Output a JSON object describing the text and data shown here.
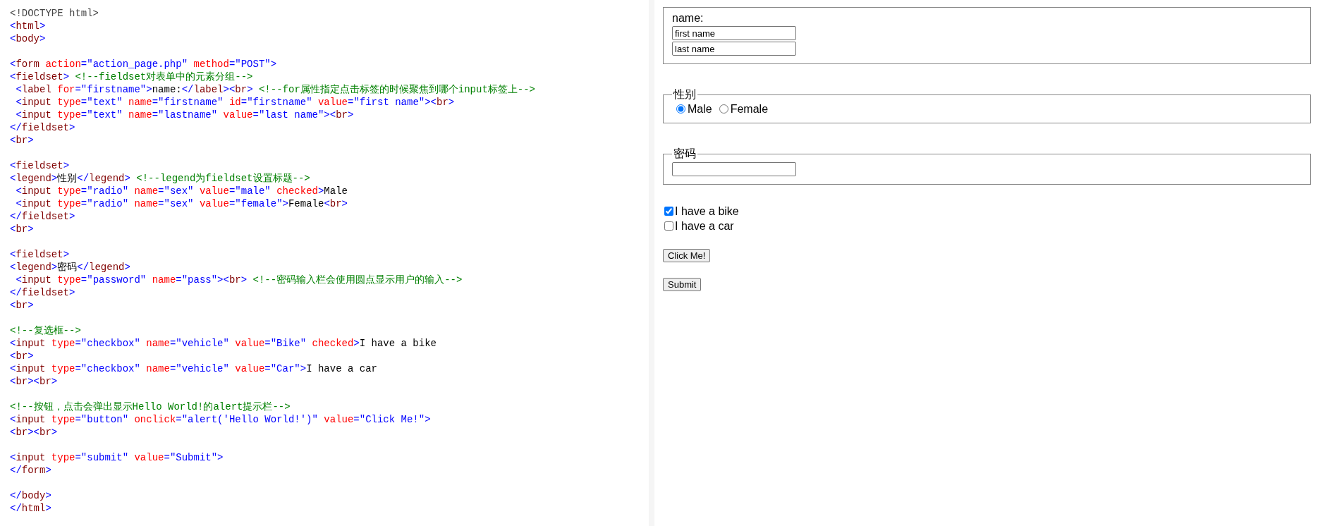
{
  "code": {
    "lines": [
      {
        "kind": "code",
        "segments": [
          {
            "kind": "doctype",
            "text": "<!DOCTYPE html>"
          }
        ]
      },
      {
        "kind": "code",
        "segments": [
          {
            "kind": "punct",
            "text": "<"
          },
          {
            "kind": "tag",
            "text": "html"
          },
          {
            "kind": "punct",
            "text": ">"
          }
        ]
      },
      {
        "kind": "code",
        "segments": [
          {
            "kind": "punct",
            "text": "<"
          },
          {
            "kind": "tag",
            "text": "body"
          },
          {
            "kind": "punct",
            "text": ">"
          }
        ]
      },
      {
        "kind": "blank"
      },
      {
        "kind": "code",
        "segments": [
          {
            "kind": "punct",
            "text": "<"
          },
          {
            "kind": "tag",
            "text": "form "
          },
          {
            "kind": "attr",
            "text": "action"
          },
          {
            "kind": "punct",
            "text": "="
          },
          {
            "kind": "value",
            "text": "\"action_page.php\" "
          },
          {
            "kind": "attr",
            "text": "method"
          },
          {
            "kind": "punct",
            "text": "="
          },
          {
            "kind": "value",
            "text": "\"POST\""
          },
          {
            "kind": "punct",
            "text": ">"
          }
        ]
      },
      {
        "kind": "code",
        "segments": [
          {
            "kind": "punct",
            "text": "<"
          },
          {
            "kind": "tag",
            "text": "fieldset"
          },
          {
            "kind": "punct",
            "text": "> "
          },
          {
            "kind": "comment",
            "text": "<!--fieldset对表单中的元素分组-->"
          }
        ]
      },
      {
        "kind": "code",
        "segments": [
          {
            "kind": "punct",
            "text": " <"
          },
          {
            "kind": "tag",
            "text": "label "
          },
          {
            "kind": "attr",
            "text": "for"
          },
          {
            "kind": "punct",
            "text": "="
          },
          {
            "kind": "value",
            "text": "\"firstname\""
          },
          {
            "kind": "punct",
            "text": ">"
          },
          {
            "kind": "text",
            "text": "name:"
          },
          {
            "kind": "punct",
            "text": "</"
          },
          {
            "kind": "tag",
            "text": "label"
          },
          {
            "kind": "punct",
            "text": "><"
          },
          {
            "kind": "tag",
            "text": "br"
          },
          {
            "kind": "punct",
            "text": "> "
          },
          {
            "kind": "comment",
            "text": "<!--for属性指定点击标签的时候聚焦到哪个input标签上-->"
          }
        ]
      },
      {
        "kind": "code",
        "segments": [
          {
            "kind": "punct",
            "text": " <"
          },
          {
            "kind": "tag",
            "text": "input "
          },
          {
            "kind": "attr",
            "text": "type"
          },
          {
            "kind": "punct",
            "text": "="
          },
          {
            "kind": "value",
            "text": "\"text\" "
          },
          {
            "kind": "attr",
            "text": "name"
          },
          {
            "kind": "punct",
            "text": "="
          },
          {
            "kind": "value",
            "text": "\"firstname\" "
          },
          {
            "kind": "attr",
            "text": "id"
          },
          {
            "kind": "punct",
            "text": "="
          },
          {
            "kind": "value",
            "text": "\"firstname\" "
          },
          {
            "kind": "attr",
            "text": "value"
          },
          {
            "kind": "punct",
            "text": "="
          },
          {
            "kind": "value",
            "text": "\"first name\""
          },
          {
            "kind": "punct",
            "text": "><"
          },
          {
            "kind": "tag",
            "text": "br"
          },
          {
            "kind": "punct",
            "text": ">"
          }
        ]
      },
      {
        "kind": "code",
        "segments": [
          {
            "kind": "punct",
            "text": " <"
          },
          {
            "kind": "tag",
            "text": "input "
          },
          {
            "kind": "attr",
            "text": "type"
          },
          {
            "kind": "punct",
            "text": "="
          },
          {
            "kind": "value",
            "text": "\"text\" "
          },
          {
            "kind": "attr",
            "text": "name"
          },
          {
            "kind": "punct",
            "text": "="
          },
          {
            "kind": "value",
            "text": "\"lastname\" "
          },
          {
            "kind": "attr",
            "text": "value"
          },
          {
            "kind": "punct",
            "text": "="
          },
          {
            "kind": "value",
            "text": "\"last name\""
          },
          {
            "kind": "punct",
            "text": "><"
          },
          {
            "kind": "tag",
            "text": "br"
          },
          {
            "kind": "punct",
            "text": ">"
          }
        ]
      },
      {
        "kind": "code",
        "segments": [
          {
            "kind": "punct",
            "text": "</"
          },
          {
            "kind": "tag",
            "text": "fieldset"
          },
          {
            "kind": "punct",
            "text": ">"
          }
        ]
      },
      {
        "kind": "code",
        "segments": [
          {
            "kind": "punct",
            "text": "<"
          },
          {
            "kind": "tag",
            "text": "br"
          },
          {
            "kind": "punct",
            "text": ">"
          }
        ]
      },
      {
        "kind": "blank"
      },
      {
        "kind": "code",
        "segments": [
          {
            "kind": "punct",
            "text": "<"
          },
          {
            "kind": "tag",
            "text": "fieldset"
          },
          {
            "kind": "punct",
            "text": ">"
          }
        ]
      },
      {
        "kind": "code",
        "segments": [
          {
            "kind": "punct",
            "text": "<"
          },
          {
            "kind": "tag",
            "text": "legend"
          },
          {
            "kind": "punct",
            "text": ">"
          },
          {
            "kind": "text",
            "text": "性别"
          },
          {
            "kind": "punct",
            "text": "</"
          },
          {
            "kind": "tag",
            "text": "legend"
          },
          {
            "kind": "punct",
            "text": "> "
          },
          {
            "kind": "comment",
            "text": "<!--legend为fieldset设置标题-->"
          }
        ]
      },
      {
        "kind": "code",
        "segments": [
          {
            "kind": "punct",
            "text": " <"
          },
          {
            "kind": "tag",
            "text": "input "
          },
          {
            "kind": "attr",
            "text": "type"
          },
          {
            "kind": "punct",
            "text": "="
          },
          {
            "kind": "value",
            "text": "\"radio\" "
          },
          {
            "kind": "attr",
            "text": "name"
          },
          {
            "kind": "punct",
            "text": "="
          },
          {
            "kind": "value",
            "text": "\"sex\" "
          },
          {
            "kind": "attr",
            "text": "value"
          },
          {
            "kind": "punct",
            "text": "="
          },
          {
            "kind": "value",
            "text": "\"male\" "
          },
          {
            "kind": "attr",
            "text": "checked"
          },
          {
            "kind": "punct",
            "text": ">"
          },
          {
            "kind": "text",
            "text": "Male"
          }
        ]
      },
      {
        "kind": "code",
        "segments": [
          {
            "kind": "punct",
            "text": " <"
          },
          {
            "kind": "tag",
            "text": "input "
          },
          {
            "kind": "attr",
            "text": "type"
          },
          {
            "kind": "punct",
            "text": "="
          },
          {
            "kind": "value",
            "text": "\"radio\" "
          },
          {
            "kind": "attr",
            "text": "name"
          },
          {
            "kind": "punct",
            "text": "="
          },
          {
            "kind": "value",
            "text": "\"sex\" "
          },
          {
            "kind": "attr",
            "text": "value"
          },
          {
            "kind": "punct",
            "text": "="
          },
          {
            "kind": "value",
            "text": "\"female\""
          },
          {
            "kind": "punct",
            "text": ">"
          },
          {
            "kind": "text",
            "text": "Female"
          },
          {
            "kind": "punct",
            "text": "<"
          },
          {
            "kind": "tag",
            "text": "br"
          },
          {
            "kind": "punct",
            "text": ">"
          }
        ]
      },
      {
        "kind": "code",
        "segments": [
          {
            "kind": "punct",
            "text": "</"
          },
          {
            "kind": "tag",
            "text": "fieldset"
          },
          {
            "kind": "punct",
            "text": ">"
          }
        ]
      },
      {
        "kind": "code",
        "segments": [
          {
            "kind": "punct",
            "text": "<"
          },
          {
            "kind": "tag",
            "text": "br"
          },
          {
            "kind": "punct",
            "text": ">"
          }
        ]
      },
      {
        "kind": "blank"
      },
      {
        "kind": "code",
        "segments": [
          {
            "kind": "punct",
            "text": "<"
          },
          {
            "kind": "tag",
            "text": "fieldset"
          },
          {
            "kind": "punct",
            "text": ">"
          }
        ]
      },
      {
        "kind": "code",
        "segments": [
          {
            "kind": "punct",
            "text": "<"
          },
          {
            "kind": "tag",
            "text": "legend"
          },
          {
            "kind": "punct",
            "text": ">"
          },
          {
            "kind": "text",
            "text": "密码"
          },
          {
            "kind": "punct",
            "text": "</"
          },
          {
            "kind": "tag",
            "text": "legend"
          },
          {
            "kind": "punct",
            "text": ">"
          }
        ]
      },
      {
        "kind": "code",
        "segments": [
          {
            "kind": "punct",
            "text": " <"
          },
          {
            "kind": "tag",
            "text": "input "
          },
          {
            "kind": "attr",
            "text": "type"
          },
          {
            "kind": "punct",
            "text": "="
          },
          {
            "kind": "value",
            "text": "\"password\" "
          },
          {
            "kind": "attr",
            "text": "name"
          },
          {
            "kind": "punct",
            "text": "="
          },
          {
            "kind": "value",
            "text": "\"pass\""
          },
          {
            "kind": "punct",
            "text": "><"
          },
          {
            "kind": "tag",
            "text": "br"
          },
          {
            "kind": "punct",
            "text": "> "
          },
          {
            "kind": "comment",
            "text": "<!--密码输入栏会使用圆点显示用户的输入-->"
          }
        ]
      },
      {
        "kind": "code",
        "segments": [
          {
            "kind": "punct",
            "text": "</"
          },
          {
            "kind": "tag",
            "text": "fieldset"
          },
          {
            "kind": "punct",
            "text": ">"
          }
        ]
      },
      {
        "kind": "code",
        "segments": [
          {
            "kind": "punct",
            "text": "<"
          },
          {
            "kind": "tag",
            "text": "br"
          },
          {
            "kind": "punct",
            "text": ">"
          }
        ]
      },
      {
        "kind": "blank"
      },
      {
        "kind": "code",
        "segments": [
          {
            "kind": "comment",
            "text": "<!--复选框-->"
          }
        ]
      },
      {
        "kind": "code",
        "segments": [
          {
            "kind": "punct",
            "text": "<"
          },
          {
            "kind": "tag",
            "text": "input "
          },
          {
            "kind": "attr",
            "text": "type"
          },
          {
            "kind": "punct",
            "text": "="
          },
          {
            "kind": "value",
            "text": "\"checkbox\" "
          },
          {
            "kind": "attr",
            "text": "name"
          },
          {
            "kind": "punct",
            "text": "="
          },
          {
            "kind": "value",
            "text": "\"vehicle\" "
          },
          {
            "kind": "attr",
            "text": "value"
          },
          {
            "kind": "punct",
            "text": "="
          },
          {
            "kind": "value",
            "text": "\"Bike\" "
          },
          {
            "kind": "attr",
            "text": "checked"
          },
          {
            "kind": "punct",
            "text": ">"
          },
          {
            "kind": "text",
            "text": "I have a bike"
          }
        ]
      },
      {
        "kind": "code",
        "segments": [
          {
            "kind": "punct",
            "text": "<"
          },
          {
            "kind": "tag",
            "text": "br"
          },
          {
            "kind": "punct",
            "text": ">"
          }
        ]
      },
      {
        "kind": "code",
        "segments": [
          {
            "kind": "punct",
            "text": "<"
          },
          {
            "kind": "tag",
            "text": "input "
          },
          {
            "kind": "attr",
            "text": "type"
          },
          {
            "kind": "punct",
            "text": "="
          },
          {
            "kind": "value",
            "text": "\"checkbox\" "
          },
          {
            "kind": "attr",
            "text": "name"
          },
          {
            "kind": "punct",
            "text": "="
          },
          {
            "kind": "value",
            "text": "\"vehicle\" "
          },
          {
            "kind": "attr",
            "text": "value"
          },
          {
            "kind": "punct",
            "text": "="
          },
          {
            "kind": "value",
            "text": "\"Car\""
          },
          {
            "kind": "punct",
            "text": ">"
          },
          {
            "kind": "text",
            "text": "I have a car"
          }
        ]
      },
      {
        "kind": "code",
        "segments": [
          {
            "kind": "punct",
            "text": "<"
          },
          {
            "kind": "tag",
            "text": "br"
          },
          {
            "kind": "punct",
            "text": "><"
          },
          {
            "kind": "tag",
            "text": "br"
          },
          {
            "kind": "punct",
            "text": ">"
          }
        ]
      },
      {
        "kind": "blank"
      },
      {
        "kind": "code",
        "segments": [
          {
            "kind": "comment",
            "text": "<!--按钮，点击会弹出显示Hello World!的alert提示栏-->"
          }
        ]
      },
      {
        "kind": "code",
        "segments": [
          {
            "kind": "punct",
            "text": "<"
          },
          {
            "kind": "tag",
            "text": "input "
          },
          {
            "kind": "attr",
            "text": "type"
          },
          {
            "kind": "punct",
            "text": "="
          },
          {
            "kind": "value",
            "text": "\"button\" "
          },
          {
            "kind": "attr",
            "text": "onclick"
          },
          {
            "kind": "punct",
            "text": "="
          },
          {
            "kind": "value",
            "text": "\"alert('Hello World!')\" "
          },
          {
            "kind": "attr",
            "text": "value"
          },
          {
            "kind": "punct",
            "text": "="
          },
          {
            "kind": "value",
            "text": "\"Click Me!\""
          },
          {
            "kind": "punct",
            "text": ">"
          }
        ]
      },
      {
        "kind": "code",
        "segments": [
          {
            "kind": "punct",
            "text": "<"
          },
          {
            "kind": "tag",
            "text": "br"
          },
          {
            "kind": "punct",
            "text": "><"
          },
          {
            "kind": "tag",
            "text": "br"
          },
          {
            "kind": "punct",
            "text": ">"
          }
        ]
      },
      {
        "kind": "blank"
      },
      {
        "kind": "code",
        "segments": [
          {
            "kind": "punct",
            "text": "<"
          },
          {
            "kind": "tag",
            "text": "input "
          },
          {
            "kind": "attr",
            "text": "type"
          },
          {
            "kind": "punct",
            "text": "="
          },
          {
            "kind": "value",
            "text": "\"submit\" "
          },
          {
            "kind": "attr",
            "text": "value"
          },
          {
            "kind": "punct",
            "text": "="
          },
          {
            "kind": "value",
            "text": "\"Submit\""
          },
          {
            "kind": "punct",
            "text": ">"
          }
        ]
      },
      {
        "kind": "code",
        "segments": [
          {
            "kind": "punct",
            "text": "</"
          },
          {
            "kind": "tag",
            "text": "form"
          },
          {
            "kind": "punct",
            "text": ">"
          }
        ]
      },
      {
        "kind": "blank"
      },
      {
        "kind": "code",
        "segments": [
          {
            "kind": "punct",
            "text": "</"
          },
          {
            "kind": "tag",
            "text": "body"
          },
          {
            "kind": "punct",
            "text": ">"
          }
        ]
      },
      {
        "kind": "code",
        "segments": [
          {
            "kind": "punct",
            "text": "</"
          },
          {
            "kind": "tag",
            "text": "html"
          },
          {
            "kind": "punct",
            "text": ">"
          }
        ]
      }
    ]
  },
  "preview": {
    "name_fieldset": {
      "label": "name:",
      "inputs": [
        {
          "value": "first name"
        },
        {
          "value": "last name"
        }
      ]
    },
    "gender_fieldset": {
      "legend": "性别",
      "options": [
        {
          "label": "Male",
          "selected": true
        },
        {
          "label": "Female",
          "selected": false
        }
      ]
    },
    "password_fieldset": {
      "legend": "密码"
    },
    "checkboxes": [
      {
        "label": "I have a bike",
        "checked": true
      },
      {
        "label": "I have a car",
        "checked": false
      }
    ],
    "buttons": [
      "Click Me!",
      "Submit"
    ]
  }
}
